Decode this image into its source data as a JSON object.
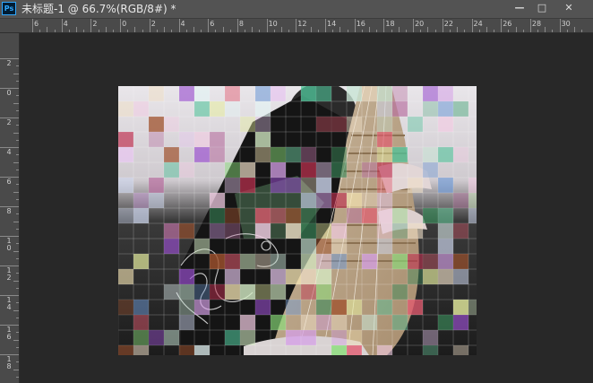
{
  "app": {
    "logo_text": "Ps",
    "tab_title": "未标题-1 @ 66.7%(RGB/8#) *"
  },
  "window_controls": {
    "minimize": "—",
    "maximize": "□",
    "close": "✕"
  },
  "ruler_top_labels": [
    "6",
    "4",
    "2",
    "0",
    "2",
    "4",
    "6",
    "8",
    "10",
    "12",
    "14",
    "16",
    "18",
    "20",
    "22",
    "24",
    "26",
    "28",
    "30"
  ],
  "ruler_left_labels": [
    "2",
    "0",
    "2",
    "4",
    "6",
    "8",
    "10",
    "12",
    "14",
    "16",
    "18"
  ],
  "colors": {
    "workspace": "#282828",
    "titlebar": "#535353",
    "ruler": "#4a4a4a"
  }
}
